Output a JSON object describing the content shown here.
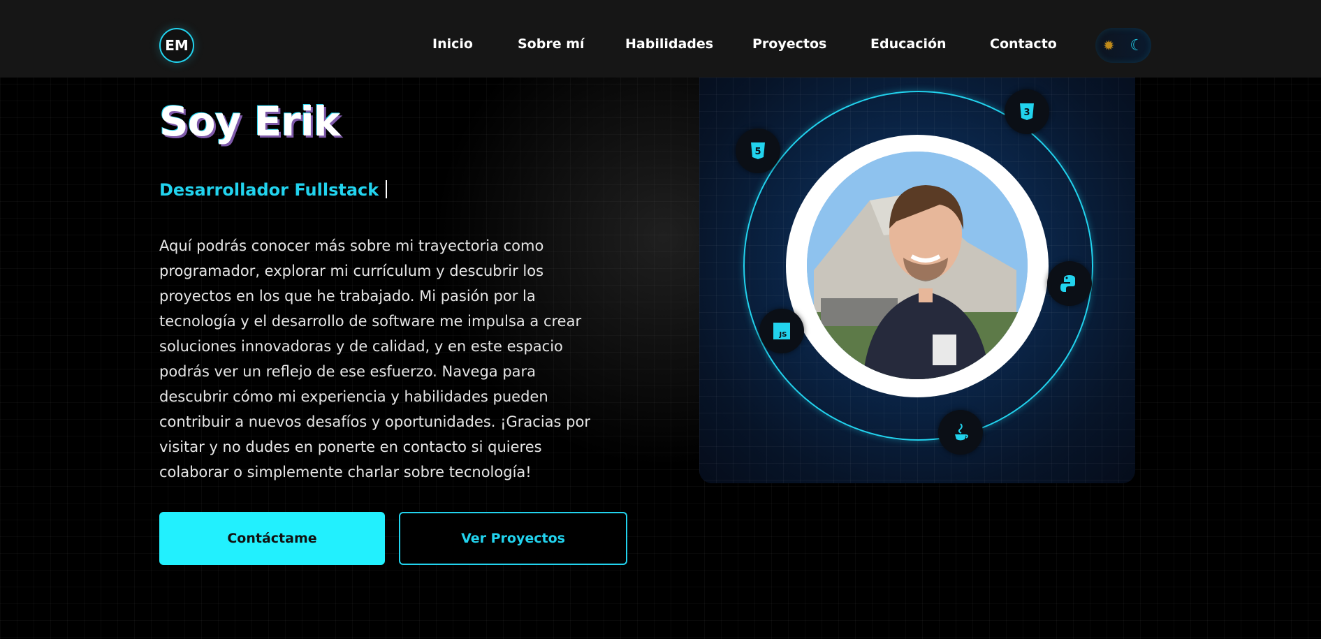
{
  "header": {
    "logo_text": "EM",
    "nav": [
      {
        "label": "Inicio"
      },
      {
        "label": "Sobre mí"
      },
      {
        "label": "Habilidades"
      },
      {
        "label": "Proyectos"
      },
      {
        "label": "Educación"
      },
      {
        "label": "Contacto"
      }
    ],
    "theme_toggle": {
      "light_icon": "sun-icon",
      "dark_icon": "moon-icon",
      "active": "dark"
    }
  },
  "hero": {
    "title": "Soy Erik",
    "subtitle": "Desarrollador Fullstack",
    "description": "Aquí podrás conocer más sobre mi trayectoria como programador, explorar mi currículum y descubrir los proyectos en los que he trabajado. Mi pasión por la tecnología y el desarrollo de software me impulsa a crear soluciones innovadoras y de calidad, y en este espacio podrás ver un reflejo de ese esfuerzo. Navega para descubrir cómo mi experiencia y habilidades pueden contribuir a nuevos desafíos y oportunidades. ¡Gracias por visitar y no dudes en ponerte en contacto si quieres colaborar o simplemente charlar sobre tecnología!",
    "primary_button": "Contáctame",
    "secondary_button": "Ver Proyectos"
  },
  "profile": {
    "tech_icons": [
      "html5-icon",
      "css3-icon",
      "python-icon",
      "javascript-icon",
      "java-icon"
    ],
    "badge_js_text": "JS",
    "badge_html_text": "5",
    "badge_css_text": "3"
  },
  "colors": {
    "accent": "#22f0fe",
    "header_bg": "#161616",
    "page_bg": "#000000"
  }
}
